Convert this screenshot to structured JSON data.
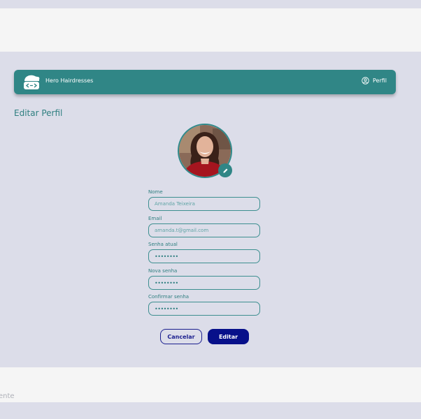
{
  "navbar": {
    "brand": "Hero Hairdresses",
    "profile_label": "Perfil"
  },
  "page": {
    "title": "Editar Perfil"
  },
  "form": {
    "name": {
      "label": "Nome",
      "value": "Amanda Teixeira"
    },
    "email": {
      "label": "Email",
      "value": "amanda.t@gmail.com"
    },
    "current_password": {
      "label": "Senha atual",
      "value": "••••••••"
    },
    "new_password": {
      "label": "Nova senha",
      "value": "••••••••"
    },
    "confirm_password": {
      "label": "Confirmar senha",
      "value": "••••••••"
    }
  },
  "actions": {
    "cancel_label": "Cancelar",
    "edit_label": "Editar"
  },
  "footer": {
    "partial_text": "ente"
  },
  "colors": {
    "primary_teal": "#308686",
    "accent_navy": "#07108a",
    "page_background": "#dcdde9"
  },
  "icons": {
    "logo": "barber-cape-logo-icon",
    "profile": "user-circle-icon",
    "edit_photo": "pencil-icon"
  }
}
